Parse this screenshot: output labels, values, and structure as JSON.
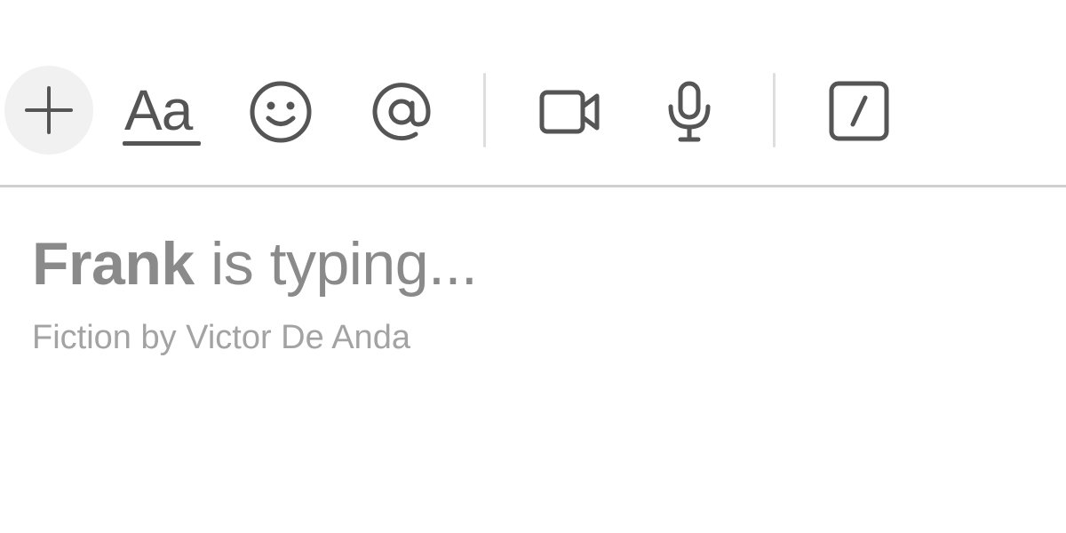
{
  "toolbar": {
    "icons": {
      "attach": "plus-icon",
      "format": "text-format-icon",
      "emoji": "smiley-icon",
      "mention": "at-sign-icon",
      "video": "video-camera-icon",
      "audio": "microphone-icon",
      "shortcut": "slash-command-icon"
    },
    "format_label": "Aa"
  },
  "message": {
    "typing_name": "Frank",
    "typing_suffix": "is typing...",
    "byline": "Fiction by Victor De Anda"
  },
  "colors": {
    "icon": "#555555",
    "typing_text": "#8a8a8a",
    "byline_text": "#a3a3a3",
    "divider": "#cfcfcf",
    "plus_bg": "#f1f1f1"
  }
}
